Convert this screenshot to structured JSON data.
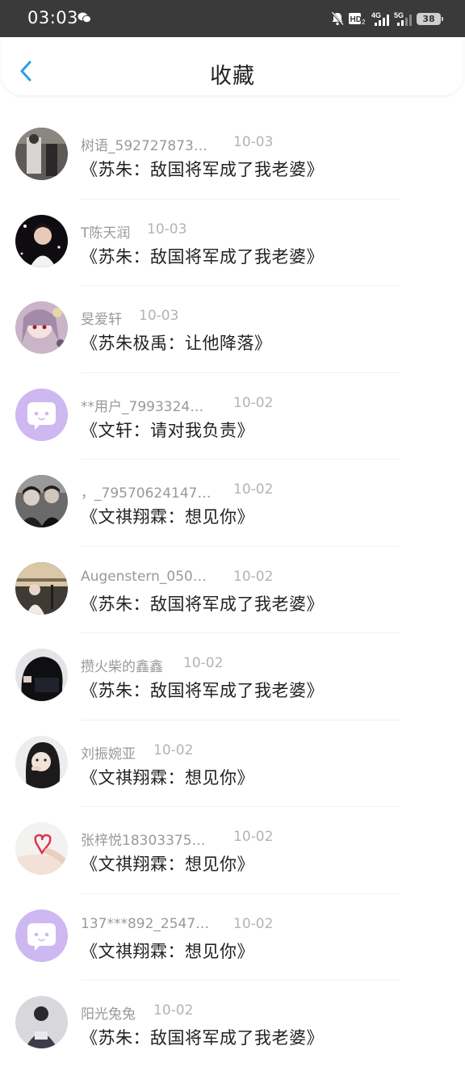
{
  "status_bar": {
    "time": "03:03",
    "battery": "38",
    "network_1": "4G",
    "network_2": "5G",
    "hd_label": "HD"
  },
  "header": {
    "title": "收藏",
    "back_icon": "chevron-left-icon",
    "accent": "#2a9ee8"
  },
  "items": [
    {
      "user": "树语_592727873…",
      "date": "10-03",
      "book": "《苏朱：敌国将军成了我老婆》",
      "avatar": "photo"
    },
    {
      "user": "T陈天润",
      "date": "10-03",
      "book": "《苏朱：敌国将军成了我老婆》",
      "avatar": "photo"
    },
    {
      "user": "旻爱轩",
      "date": "10-03",
      "book": "《苏朱极禹：让他降落》",
      "avatar": "photo"
    },
    {
      "user": "**用户_7993324…",
      "date": "10-02",
      "book": "《文轩：请对我负责》",
      "avatar": "default"
    },
    {
      "user": "，_79570624147…",
      "date": "10-02",
      "book": "《文祺翔霖：想见你》",
      "avatar": "photo"
    },
    {
      "user": "Augenstern_050…",
      "date": "10-02",
      "book": "《苏朱：敌国将军成了我老婆》",
      "avatar": "photo"
    },
    {
      "user": "攒火柴的鑫鑫",
      "date": "10-02",
      "book": "《苏朱：敌国将军成了我老婆》",
      "avatar": "photo"
    },
    {
      "user": "刘振婉亚",
      "date": "10-02",
      "book": "《文祺翔霖：想见你》",
      "avatar": "photo"
    },
    {
      "user": "张梓悦18303375…",
      "date": "10-02",
      "book": "《文祺翔霖：想见你》",
      "avatar": "photo"
    },
    {
      "user": "137***892_2547…",
      "date": "10-02",
      "book": "《文祺翔霖：想见你》",
      "avatar": "default"
    },
    {
      "user": "阳光兔兔",
      "date": "10-02",
      "book": "《苏朱：敌国将军成了我老婆》",
      "avatar": "photo"
    }
  ]
}
